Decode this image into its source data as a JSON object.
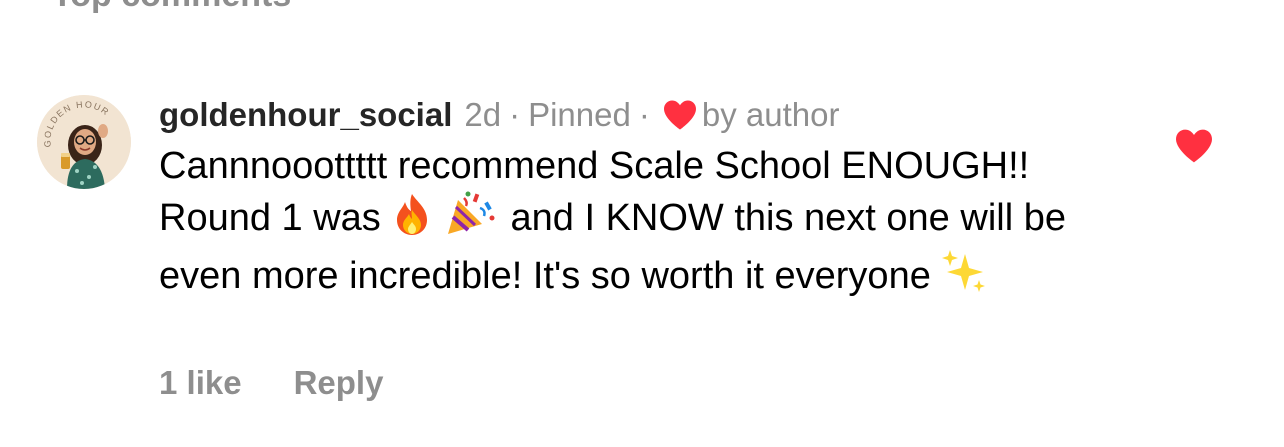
{
  "section": {
    "header": "Top comments"
  },
  "comment": {
    "username": "goldenhour_social",
    "timestamp": "2d",
    "pinned_label": "Pinned",
    "separator": "·",
    "liked_by_label": "by author",
    "text_part1": "Cannnooottttt recommend Scale School ENOUGH!! Round 1 was",
    "text_part2": "and I KNOW this next one will be even more incredible! It's so worth it everyone",
    "emojis": [
      "fire-emoji",
      "party-popper-emoji",
      "sparkles-emoji"
    ],
    "likes": "1 like",
    "reply_label": "Reply",
    "avatar_text": "GOLDEN HOUR"
  },
  "colors": {
    "heart_red": "#ff3040",
    "meta_gray": "#8e8e8e",
    "text_black": "#000000",
    "username": "#262626"
  }
}
